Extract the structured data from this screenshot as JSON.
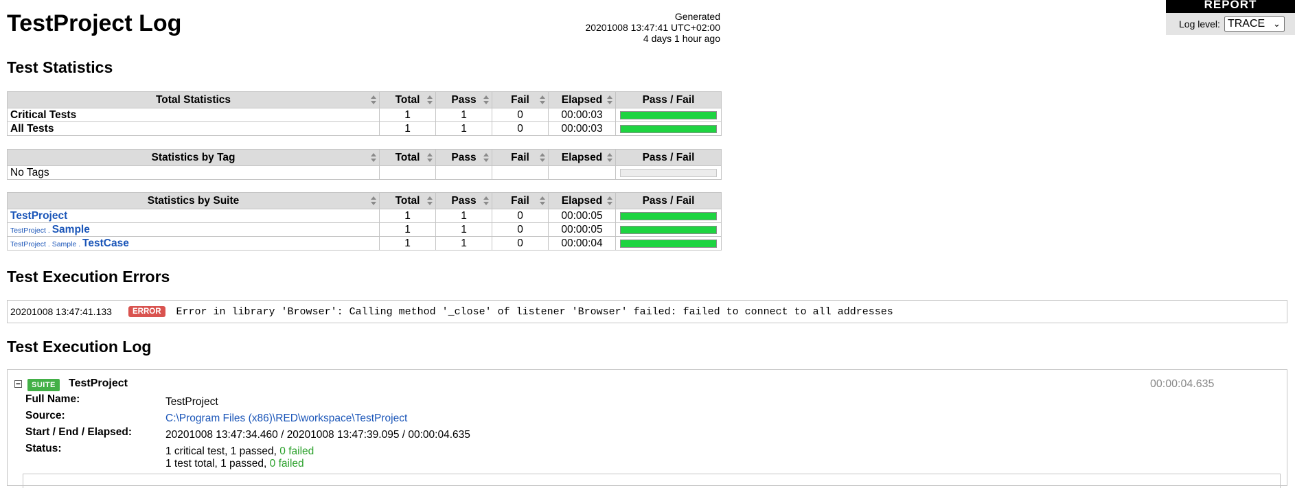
{
  "header": {
    "title": "TestProject Log",
    "generated_label": "Generated",
    "generated_time": "20201008 13:47:41 UTC+02:00",
    "generated_ago": "4 days 1 hour ago"
  },
  "report_link": "REPORT",
  "log_level": {
    "label": "Log level:",
    "value": "TRACE"
  },
  "test_statistics": {
    "heading": "Test Statistics",
    "columns": [
      "Total",
      "Pass",
      "Fail",
      "Elapsed",
      "Pass / Fail"
    ],
    "total": {
      "header": "Total Statistics",
      "rows": [
        {
          "name": "Critical Tests",
          "total": "1",
          "pass": "1",
          "fail": "0",
          "elapsed": "00:00:03",
          "pass_ratio": 1.0
        },
        {
          "name": "All Tests",
          "total": "1",
          "pass": "1",
          "fail": "0",
          "elapsed": "00:00:03",
          "pass_ratio": 1.0
        }
      ]
    },
    "by_tag": {
      "header": "Statistics by Tag",
      "rows": [
        {
          "name": "No Tags",
          "total": "",
          "pass": "",
          "fail": "",
          "elapsed": "",
          "pass_ratio": null
        }
      ]
    },
    "by_suite": {
      "header": "Statistics by Suite",
      "rows": [
        {
          "prefix": "",
          "name": "TestProject",
          "total": "1",
          "pass": "1",
          "fail": "0",
          "elapsed": "00:00:05",
          "pass_ratio": 1.0
        },
        {
          "prefix": "TestProject . ",
          "name": "Sample",
          "total": "1",
          "pass": "1",
          "fail": "0",
          "elapsed": "00:00:05",
          "pass_ratio": 1.0
        },
        {
          "prefix": "TestProject . Sample . ",
          "name": "TestCase",
          "total": "1",
          "pass": "1",
          "fail": "0",
          "elapsed": "00:00:04",
          "pass_ratio": 1.0
        }
      ]
    }
  },
  "errors": {
    "heading": "Test Execution Errors",
    "items": [
      {
        "time": "20201008 13:47:41.133",
        "level": "ERROR",
        "message": "Error in library 'Browser': Calling method '_close' of listener 'Browser' failed: failed to connect to all addresses"
      }
    ]
  },
  "execution_log": {
    "heading": "Test Execution Log",
    "toggle": "−",
    "badge": "SUITE",
    "name": "TestProject",
    "elapsed": "00:00:04.635",
    "full_name_label": "Full Name:",
    "full_name": "TestProject",
    "source_label": "Source:",
    "source": "C:\\Program Files (x86)\\RED\\workspace\\TestProject",
    "times_label": "Start / End / Elapsed:",
    "times": "20201008 13:47:34.460 / 20201008 13:47:39.095 / 00:00:04.635",
    "status_label": "Status:",
    "status_critical": "1 critical test, 1 passed, ",
    "status_critical_failed": "0 failed",
    "status_total": "1 test total, 1 passed, ",
    "status_total_failed": "0 failed"
  },
  "colors": {
    "pass": "#1ed441",
    "error": "#d9534f",
    "suite_badge": "#43b047",
    "link": "#1a55b8"
  }
}
